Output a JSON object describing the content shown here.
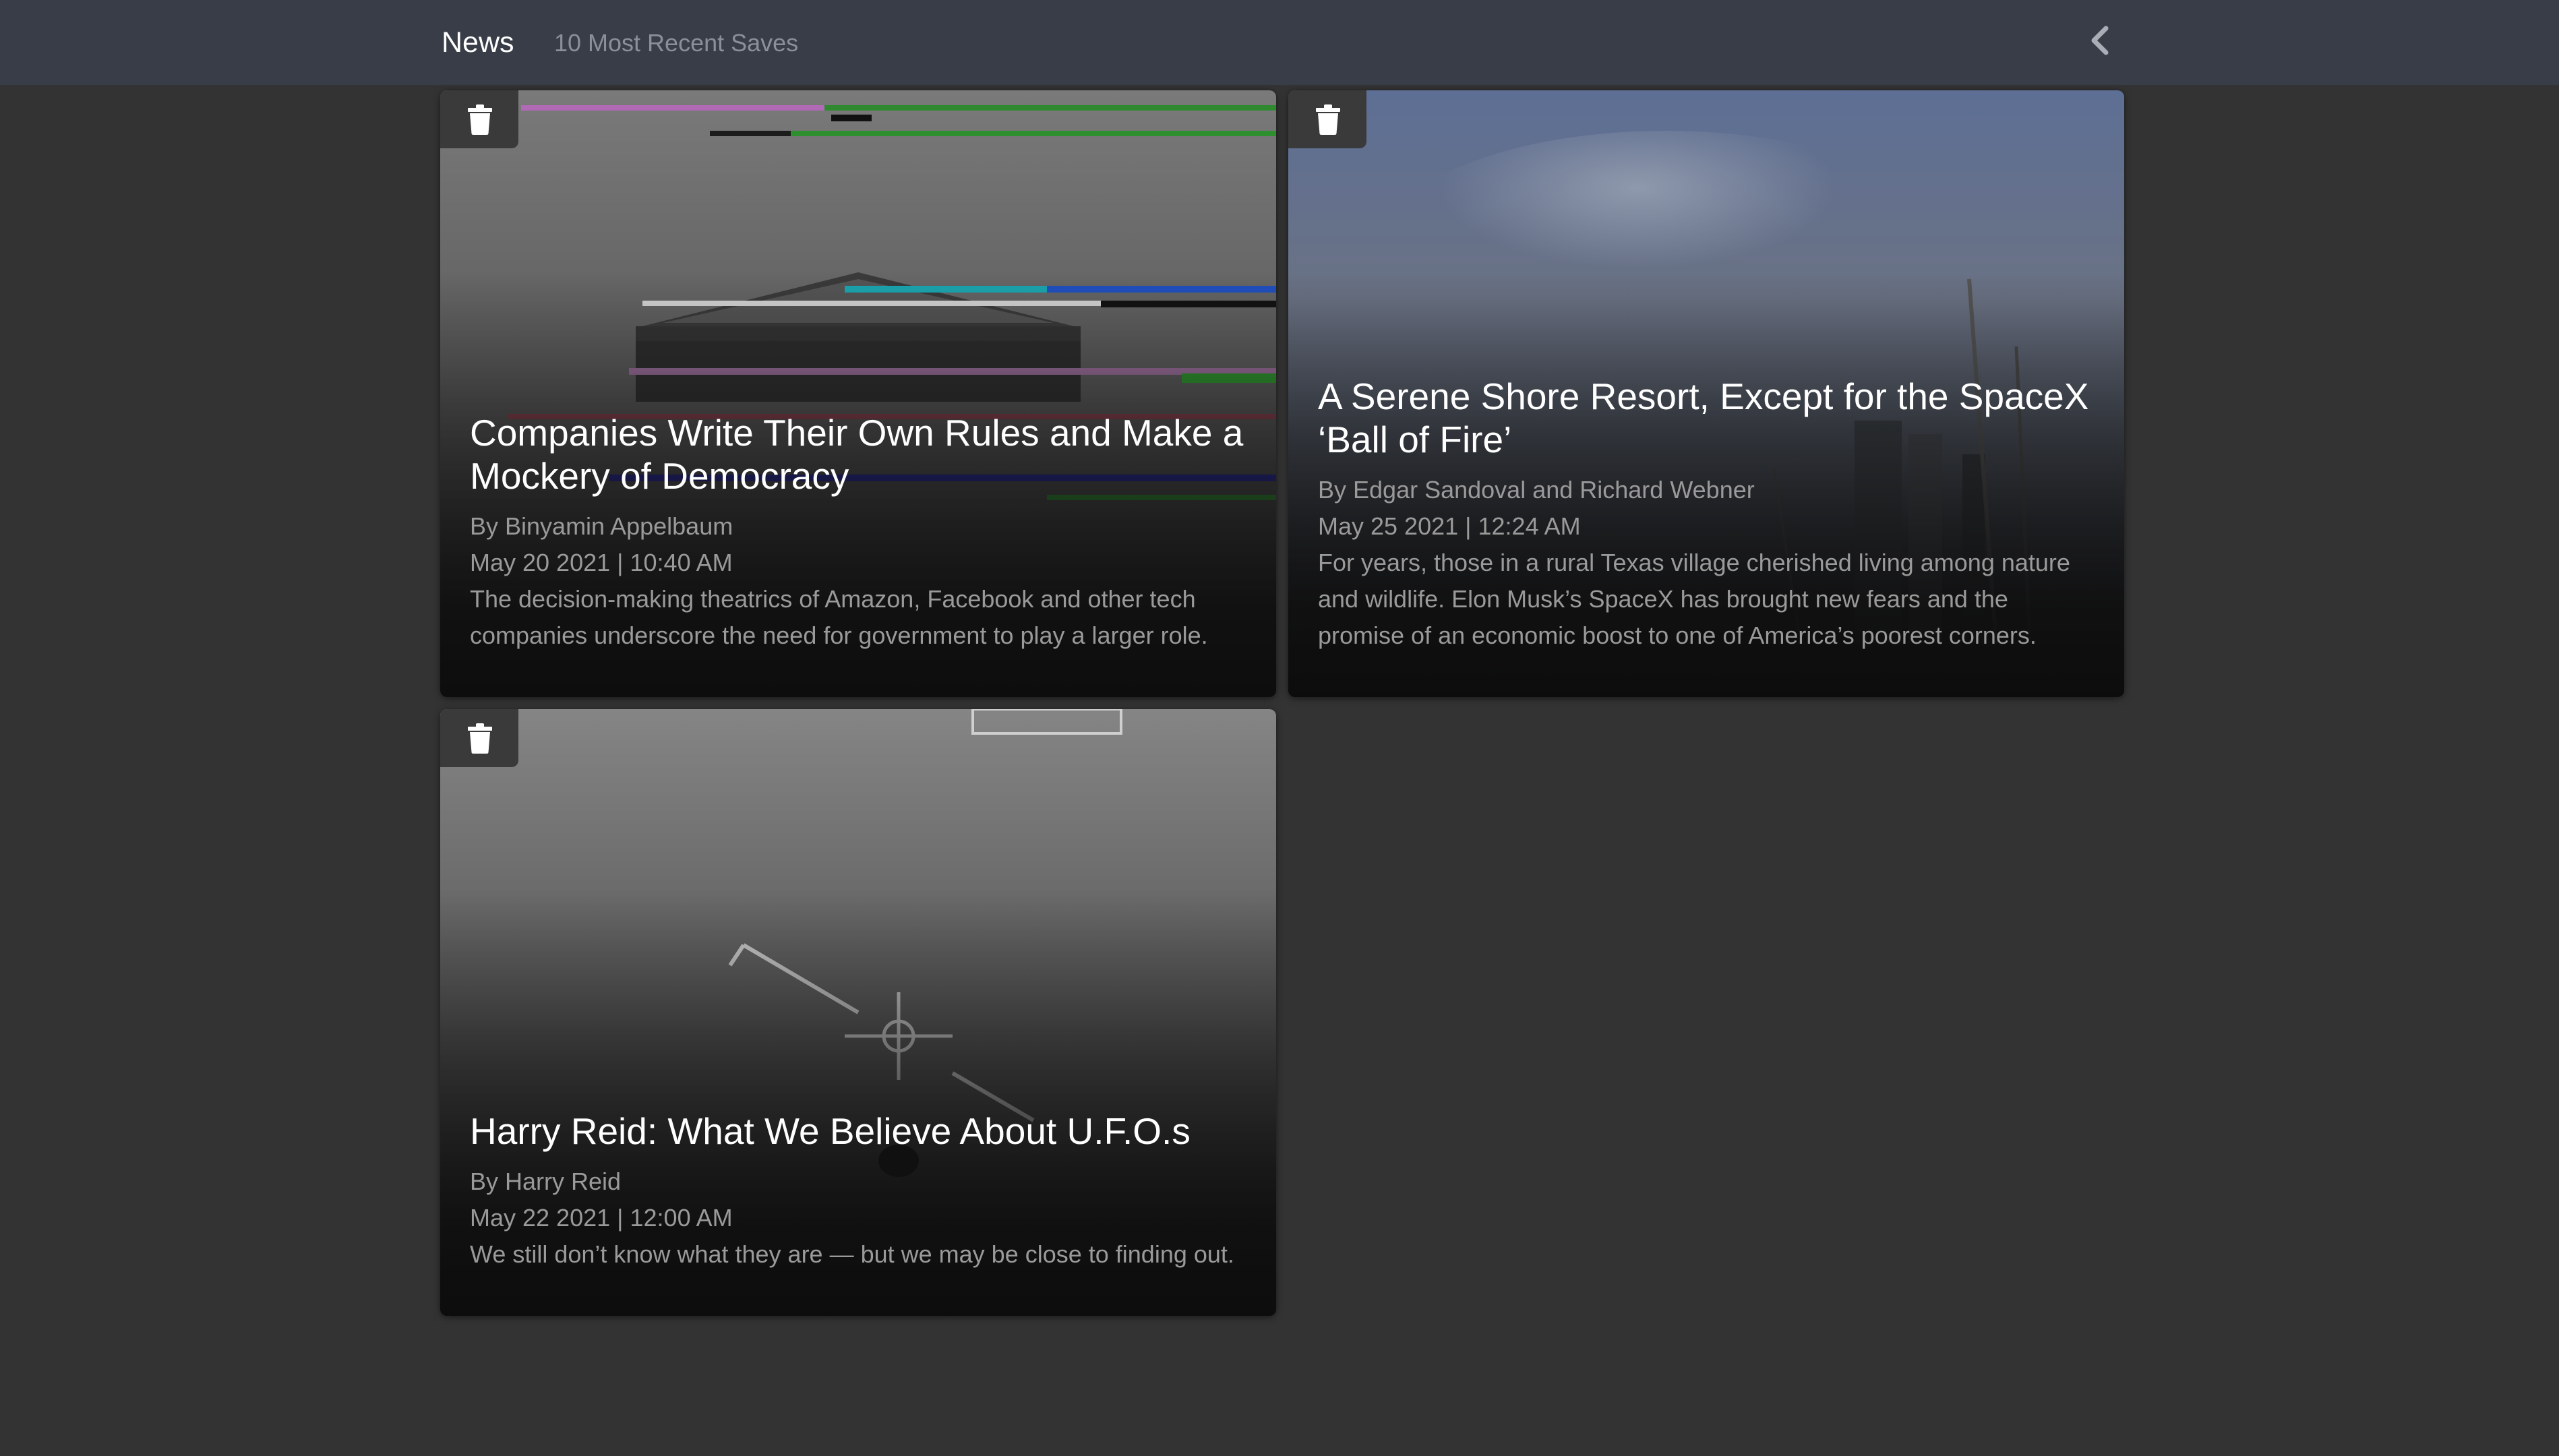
{
  "header": {
    "title": "News",
    "subtitle": "10 Most Recent Saves",
    "back_icon": "chevron-left-icon"
  },
  "articles": [
    {
      "title": "Companies Write Their Own Rules and Make a Mockery of Democracy",
      "byline": "By Binyamin Appelbaum",
      "date": "May 20 2021 | 10:40 AM",
      "summary": "The decision-making theatrics of Amazon, Facebook and other tech companies underscore the need for government to play a larger role.",
      "delete_icon": "trash-icon"
    },
    {
      "title": "A Serene Shore Resort, Except for the SpaceX ‘Ball of Fire’",
      "byline": "By Edgar Sandoval and Richard Webner",
      "date": "May 25 2021 | 12:24 AM",
      "summary": "For years, those in a rural Texas village cherished living among nature and wildlife. Elon Musk’s SpaceX has brought new fears and the promise of an economic boost to one of America’s poorest corners.",
      "delete_icon": "trash-icon"
    },
    {
      "title": "Harry Reid: What We Believe About U.F.O.s",
      "byline": "By Harry Reid",
      "date": "May 22 2021 | 12:00 AM",
      "summary": "We still don’t know what they are — but we may be close to finding out.",
      "delete_icon": "trash-icon"
    }
  ],
  "colors": {
    "background": "#333333",
    "header": "#383d47",
    "title_text": "#ffffff",
    "muted_text": "#9a9a9a"
  }
}
